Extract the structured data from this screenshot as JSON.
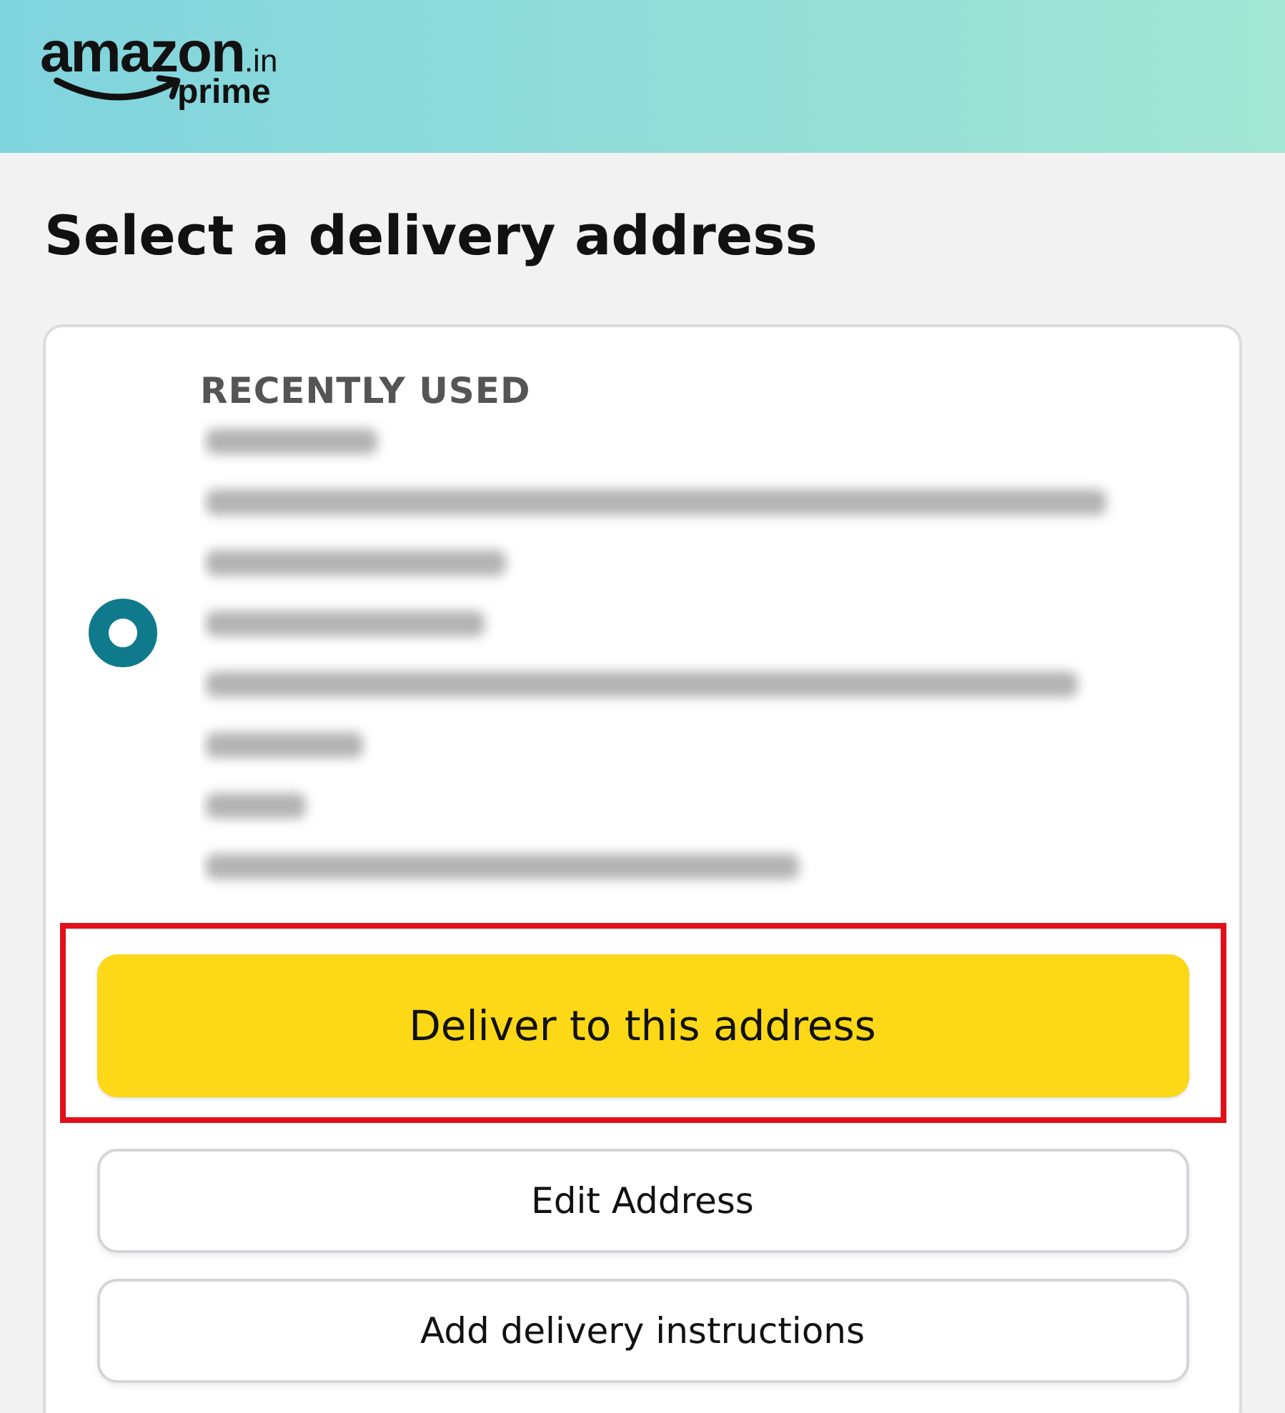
{
  "header": {
    "logo": {
      "brand": "amazon",
      "domain": ".in",
      "tier": "prime"
    }
  },
  "title": "Select a delivery address",
  "address_card": {
    "section_label": "RECENTLY USED",
    "selected": true,
    "details": {
      "kind": "redacted"
    },
    "primary_button": {
      "label": "Deliver to this address",
      "highlighted": true
    },
    "buttons": [
      {
        "label": "Edit Address"
      },
      {
        "label": "Add delivery instructions"
      }
    ]
  }
}
